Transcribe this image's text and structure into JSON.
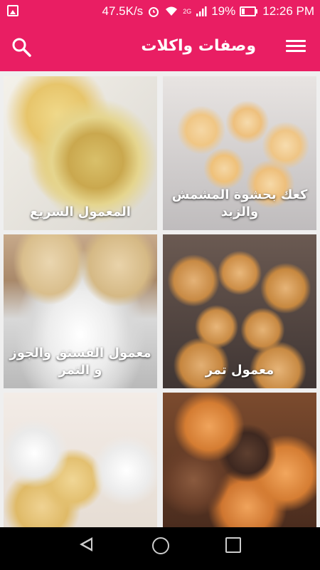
{
  "status": {
    "speed": "47.5K/s",
    "battery": "19%",
    "time": "12:26 PM",
    "network_badge": "2G"
  },
  "appbar": {
    "title": "وصفات واكلات"
  },
  "cards": [
    {
      "label": "المعمول السريع"
    },
    {
      "label": "كعك بحشوة المشمش والزبد"
    },
    {
      "label": "معمول الفستق والجوز و التمر"
    },
    {
      "label": "معمول تمر"
    },
    {
      "label": ""
    },
    {
      "label": ""
    }
  ],
  "colors": {
    "primary": "#e91e63",
    "background": "#efefef"
  },
  "icons": [
    "photo-icon",
    "alarm-icon",
    "wifi-icon",
    "signal-icon",
    "battery-icon",
    "search-icon",
    "menu-icon",
    "back-icon",
    "home-icon",
    "recents-icon"
  ]
}
